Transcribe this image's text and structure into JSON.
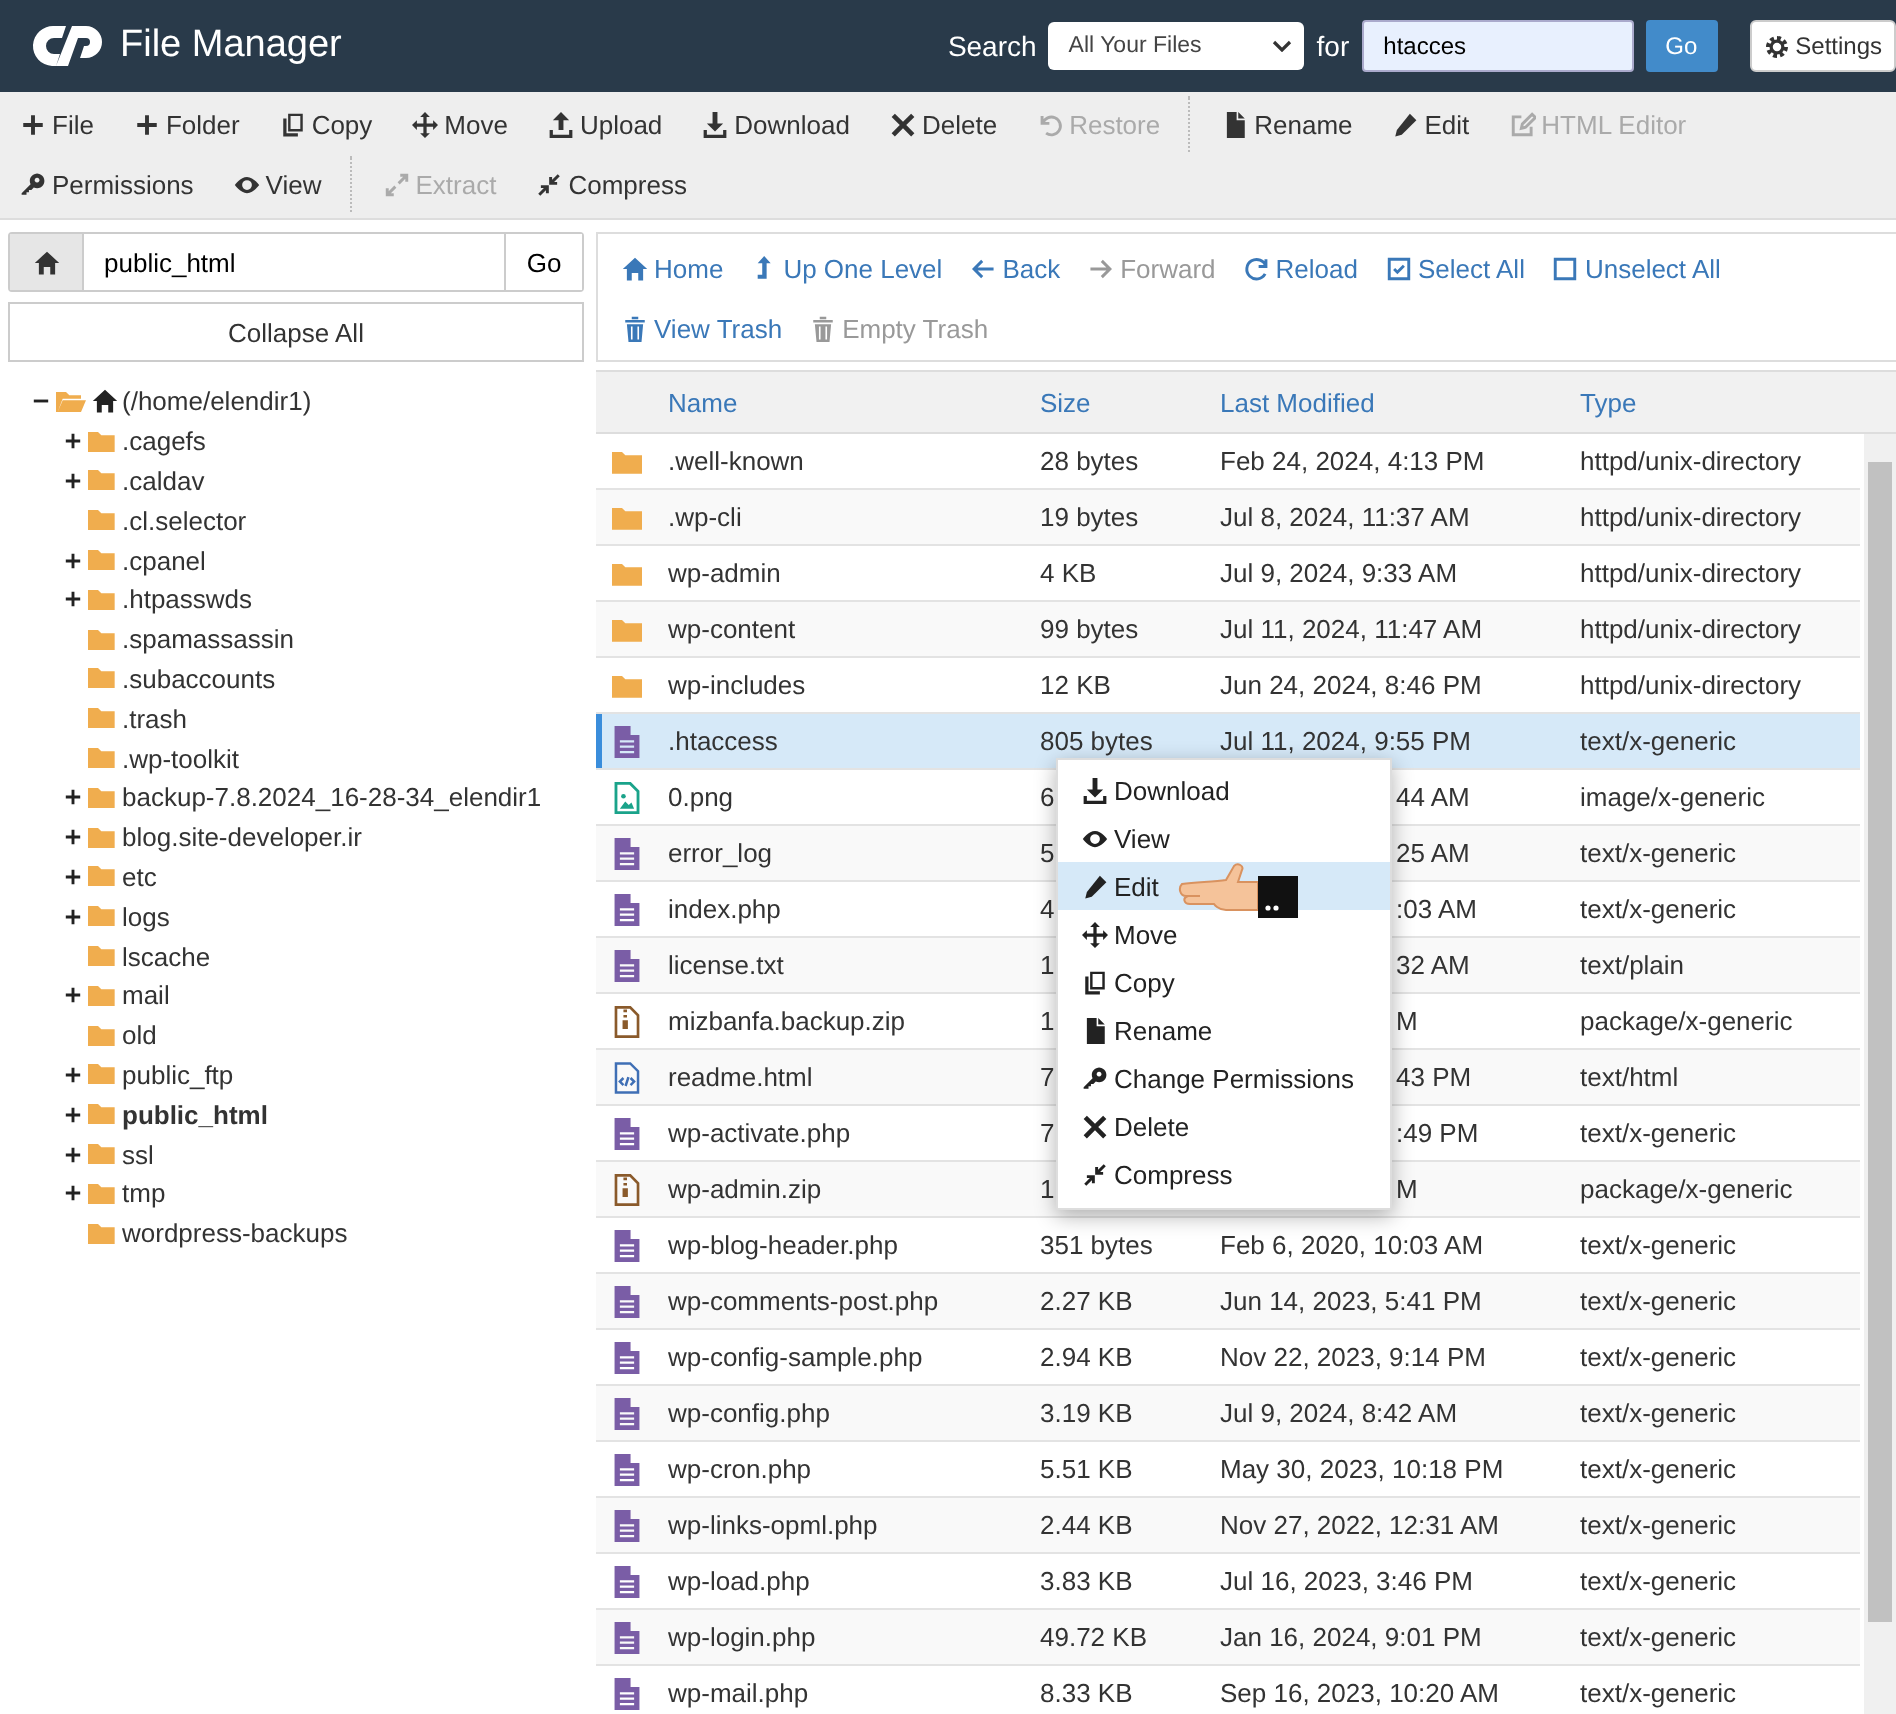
{
  "header": {
    "title": "File Manager",
    "search_label": "Search",
    "scope": "All Your Files",
    "for_label": "for",
    "query": "htacces",
    "go": "Go",
    "settings": "Settings"
  },
  "toolbar": {
    "items": [
      {
        "label": "File",
        "disabled": false,
        "divider_before": false
      },
      {
        "label": "Folder",
        "disabled": false,
        "divider_before": false
      },
      {
        "label": "Copy",
        "disabled": false,
        "divider_before": false
      },
      {
        "label": "Move",
        "disabled": false,
        "divider_before": false
      },
      {
        "label": "Upload",
        "disabled": false,
        "divider_before": false
      },
      {
        "label": "Download",
        "disabled": false,
        "divider_before": false
      },
      {
        "label": "Delete",
        "disabled": false,
        "divider_before": false
      },
      {
        "label": "Restore",
        "disabled": true,
        "divider_before": false
      },
      {
        "label": "Rename",
        "disabled": false,
        "divider_before": true
      },
      {
        "label": "Edit",
        "disabled": false,
        "divider_before": false
      },
      {
        "label": "HTML Editor",
        "disabled": true,
        "divider_before": false
      },
      {
        "label": "Permissions",
        "disabled": false,
        "divider_before": false
      },
      {
        "label": "View",
        "disabled": false,
        "divider_before": false
      },
      {
        "label": "Extract",
        "disabled": true,
        "divider_before": true
      },
      {
        "label": "Compress",
        "disabled": false,
        "divider_before": false
      }
    ]
  },
  "path_bar": {
    "value": "public_html",
    "go": "Go"
  },
  "collapse_all": "Collapse All",
  "tree": {
    "label": "(/home/elendir1)",
    "has_children": true,
    "expanded": true,
    "selected": false,
    "children": [
      {
        "label": ".cagefs",
        "has_children": true,
        "expanded": false,
        "selected": false
      },
      {
        "label": ".caldav",
        "has_children": true,
        "expanded": false,
        "selected": false
      },
      {
        "label": ".cl.selector",
        "has_children": false,
        "expanded": false,
        "selected": false
      },
      {
        "label": ".cpanel",
        "has_children": true,
        "expanded": false,
        "selected": false
      },
      {
        "label": ".htpasswds",
        "has_children": true,
        "expanded": false,
        "selected": false
      },
      {
        "label": ".spamassassin",
        "has_children": false,
        "expanded": false,
        "selected": false
      },
      {
        "label": ".subaccounts",
        "has_children": false,
        "expanded": false,
        "selected": false
      },
      {
        "label": ".trash",
        "has_children": false,
        "expanded": false,
        "selected": false
      },
      {
        "label": ".wp-toolkit",
        "has_children": false,
        "expanded": false,
        "selected": false
      },
      {
        "label": "backup-7.8.2024_16-28-34_elendir1",
        "has_children": true,
        "expanded": false,
        "selected": false
      },
      {
        "label": "blog.site-developer.ir",
        "has_children": true,
        "expanded": false,
        "selected": false
      },
      {
        "label": "etc",
        "has_children": true,
        "expanded": false,
        "selected": false
      },
      {
        "label": "logs",
        "has_children": true,
        "expanded": false,
        "selected": false
      },
      {
        "label": "lscache",
        "has_children": false,
        "expanded": false,
        "selected": false
      },
      {
        "label": "mail",
        "has_children": true,
        "expanded": false,
        "selected": false
      },
      {
        "label": "old",
        "has_children": false,
        "expanded": false,
        "selected": false
      },
      {
        "label": "public_ftp",
        "has_children": true,
        "expanded": false,
        "selected": false
      },
      {
        "label": "public_html",
        "has_children": true,
        "expanded": false,
        "selected": true
      },
      {
        "label": "ssl",
        "has_children": true,
        "expanded": false,
        "selected": false
      },
      {
        "label": "tmp",
        "has_children": true,
        "expanded": false,
        "selected": false
      },
      {
        "label": "wordpress-backups",
        "has_children": false,
        "expanded": false,
        "selected": false
      }
    ]
  },
  "nav": {
    "rows": [
      [
        {
          "label": "Home",
          "disabled": false
        },
        {
          "label": "Up One Level",
          "disabled": false
        },
        {
          "label": "Back",
          "disabled": false
        },
        {
          "label": "Forward",
          "disabled": true
        },
        {
          "label": "Reload",
          "disabled": false
        },
        {
          "label": "Select All",
          "disabled": false
        },
        {
          "label": "Unselect All",
          "disabled": false
        }
      ],
      [
        {
          "label": "View Trash",
          "disabled": false
        },
        {
          "label": "Empty Trash",
          "disabled": true
        }
      ]
    ]
  },
  "table": {
    "columns": [
      "Name",
      "Size",
      "Last Modified",
      "Type"
    ],
    "rows": [
      {
        "kind": "folder",
        "name": ".well-known",
        "size": "28 bytes",
        "modified": "Feb 24, 2024, 4:13 PM",
        "type": "httpd/unix-directory",
        "selected": false
      },
      {
        "kind": "folder",
        "name": ".wp-cli",
        "size": "19 bytes",
        "modified": "Jul 8, 2024, 11:37 AM",
        "type": "httpd/unix-directory",
        "selected": false
      },
      {
        "kind": "folder",
        "name": "wp-admin",
        "size": "4 KB",
        "modified": "Jul 9, 2024, 9:33 AM",
        "type": "httpd/unix-directory",
        "selected": false
      },
      {
        "kind": "folder",
        "name": "wp-content",
        "size": "99 bytes",
        "modified": "Jul 11, 2024, 11:47 AM",
        "type": "httpd/unix-directory",
        "selected": false
      },
      {
        "kind": "folder",
        "name": "wp-includes",
        "size": "12 KB",
        "modified": "Jun 24, 2024, 8:46 PM",
        "type": "httpd/unix-directory",
        "selected": false
      },
      {
        "kind": "text",
        "name": ".htaccess",
        "size": "805 bytes",
        "modified": "Jul 11, 2024, 9:55 PM",
        "type": "text/x-generic",
        "selected": true
      },
      {
        "kind": "image",
        "name": "0.png",
        "size": "6",
        "modified": "44 AM",
        "type": "image/x-generic",
        "selected": false
      },
      {
        "kind": "text",
        "name": "error_log",
        "size": "5",
        "modified": "25 AM",
        "type": "text/x-generic",
        "selected": false
      },
      {
        "kind": "text",
        "name": "index.php",
        "size": "4",
        "modified": ":03 AM",
        "type": "text/x-generic",
        "selected": false
      },
      {
        "kind": "text",
        "name": "license.txt",
        "size": "1",
        "modified": "32 AM",
        "type": "text/plain",
        "selected": false
      },
      {
        "kind": "zip",
        "name": "mizbanfa.backup.zip",
        "size": "1",
        "modified": "M",
        "type": "package/x-generic",
        "selected": false
      },
      {
        "kind": "html",
        "name": "readme.html",
        "size": "7",
        "modified": "43 PM",
        "type": "text/html",
        "selected": false
      },
      {
        "kind": "text",
        "name": "wp-activate.php",
        "size": "7",
        "modified": ":49 PM",
        "type": "text/x-generic",
        "selected": false
      },
      {
        "kind": "zip",
        "name": "wp-admin.zip",
        "size": "1",
        "modified": "M",
        "type": "package/x-generic",
        "selected": false
      },
      {
        "kind": "text",
        "name": "wp-blog-header.php",
        "size": "351 bytes",
        "modified": "Feb 6, 2020, 10:03 AM",
        "type": "text/x-generic",
        "selected": false
      },
      {
        "kind": "text",
        "name": "wp-comments-post.php",
        "size": "2.27 KB",
        "modified": "Jun 14, 2023, 5:41 PM",
        "type": "text/x-generic",
        "selected": false
      },
      {
        "kind": "text",
        "name": "wp-config-sample.php",
        "size": "2.94 KB",
        "modified": "Nov 22, 2023, 9:14 PM",
        "type": "text/x-generic",
        "selected": false
      },
      {
        "kind": "text",
        "name": "wp-config.php",
        "size": "3.19 KB",
        "modified": "Jul 9, 2024, 8:42 AM",
        "type": "text/x-generic",
        "selected": false
      },
      {
        "kind": "text",
        "name": "wp-cron.php",
        "size": "5.51 KB",
        "modified": "May 30, 2023, 10:18 PM",
        "type": "text/x-generic",
        "selected": false
      },
      {
        "kind": "text",
        "name": "wp-links-opml.php",
        "size": "2.44 KB",
        "modified": "Nov 27, 2022, 12:31 AM",
        "type": "text/x-generic",
        "selected": false
      },
      {
        "kind": "text",
        "name": "wp-load.php",
        "size": "3.83 KB",
        "modified": "Jul 16, 2023, 3:46 PM",
        "type": "text/x-generic",
        "selected": false
      },
      {
        "kind": "text",
        "name": "wp-login.php",
        "size": "49.72 KB",
        "modified": "Jan 16, 2024, 9:01 PM",
        "type": "text/x-generic",
        "selected": false
      },
      {
        "kind": "text",
        "name": "wp-mail.php",
        "size": "8.33 KB",
        "modified": "Sep 16, 2023, 10:20 AM",
        "type": "text/x-generic",
        "selected": false
      }
    ]
  },
  "context_menu": {
    "items": [
      {
        "label": "Download",
        "selected": false
      },
      {
        "label": "View",
        "selected": false
      },
      {
        "label": "Edit",
        "selected": true
      },
      {
        "label": "Move",
        "selected": false
      },
      {
        "label": "Copy",
        "selected": false
      },
      {
        "label": "Rename",
        "selected": false
      },
      {
        "label": "Change Permissions",
        "selected": false
      },
      {
        "label": "Delete",
        "selected": false
      },
      {
        "label": "Compress",
        "selected": false
      }
    ]
  }
}
